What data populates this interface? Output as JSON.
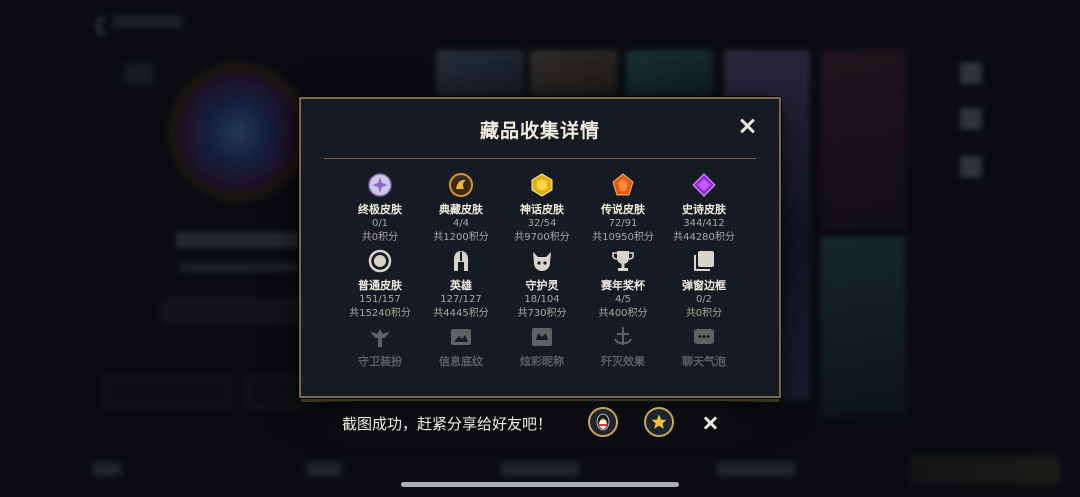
{
  "modal": {
    "title": "藏品收集详情",
    "rows": [
      [
        {
          "name": "终极皮肤",
          "count": "0/1",
          "points": "共0积分",
          "icon": "ultimate-skin-icon"
        },
        {
          "name": "典藏皮肤",
          "count": "4/4",
          "points": "共1200积分",
          "icon": "collection-skin-icon"
        },
        {
          "name": "神话皮肤",
          "count": "32/54",
          "points": "共9700积分",
          "icon": "mythic-skin-icon"
        },
        {
          "name": "传说皮肤",
          "count": "72/91",
          "points": "共10950积分",
          "icon": "legendary-skin-icon"
        },
        {
          "name": "史诗皮肤",
          "count": "344/412",
          "points": "共44280积分",
          "icon": "epic-skin-icon"
        }
      ],
      [
        {
          "name": "普通皮肤",
          "count": "151/157",
          "points": "共15240积分",
          "icon": "normal-skin-icon"
        },
        {
          "name": "英雄",
          "count": "127/127",
          "points": "共4445积分",
          "icon": "hero-helmet-icon"
        },
        {
          "name": "守护灵",
          "count": "18/104",
          "points": "共730积分",
          "icon": "guardian-spirit-icon"
        },
        {
          "name": "赛年奖杯",
          "count": "4/5",
          "points": "共400积分",
          "icon": "trophy-icon"
        },
        {
          "name": "弹窗边框",
          "count": "0/2",
          "points": "共0积分",
          "icon": "popup-frame-icon"
        }
      ],
      [
        {
          "name": "守卫装扮",
          "icon": "ward-outfit-icon"
        },
        {
          "name": "信息底纹",
          "icon": "info-background-icon"
        },
        {
          "name": "炫彩昵称",
          "icon": "colorful-nickname-icon"
        },
        {
          "name": "歼灭效果",
          "icon": "annihilation-effect-icon"
        },
        {
          "name": "聊天气泡",
          "icon": "chat-bubble-icon"
        }
      ]
    ]
  },
  "toast": {
    "text": "截图成功，赶紧分享给好友吧！",
    "share_qq_icon": "qq-penguin-icon",
    "share_favorite_icon": "star-icon"
  },
  "colors": {
    "accent_gold": "#c9a75a",
    "modal_border": "#7c6a45",
    "modal_bg": "#161a22"
  }
}
